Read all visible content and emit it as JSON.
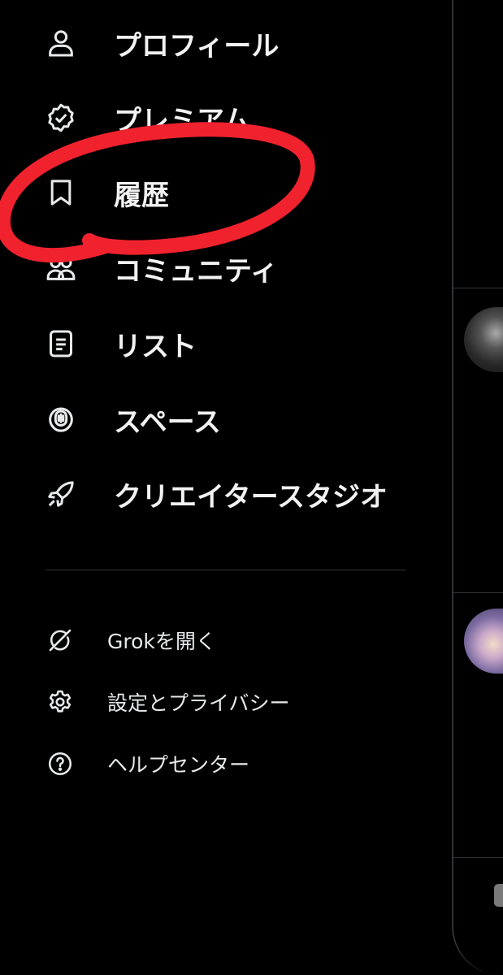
{
  "drawer": {
    "main_items": [
      {
        "label": "プロフィール",
        "icon": "person-icon"
      },
      {
        "label": "プレミアム",
        "icon": "verified-badge-icon"
      },
      {
        "label": "履歴",
        "icon": "bookmark-icon"
      },
      {
        "label": "コミュニティ",
        "icon": "communities-icon"
      },
      {
        "label": "リスト",
        "icon": "list-icon"
      },
      {
        "label": "スペース",
        "icon": "spaces-mic-icon"
      },
      {
        "label": "クリエイタースタジオ",
        "icon": "rocket-icon"
      }
    ],
    "sub_items": [
      {
        "label": "Grokを開く",
        "icon": "grok-icon"
      },
      {
        "label": "設定とプライバシー",
        "icon": "gear-icon"
      },
      {
        "label": "ヘルプセンター",
        "icon": "help-icon"
      }
    ]
  },
  "colors": {
    "background": "#000000",
    "text": "#e7e9ea",
    "divider": "#2f3336",
    "annotation": "#f0222e"
  }
}
